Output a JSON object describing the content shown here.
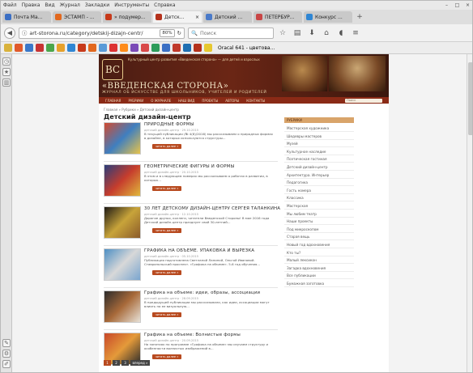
{
  "menu": [
    "Файл",
    "Правка",
    "Вид",
    "Журнал",
    "Закладки",
    "Инструменты",
    "Справка"
  ],
  "window_controls": [
    "–",
    "□",
    "×"
  ],
  "tabs": [
    {
      "label": "Почта Ма...",
      "color": "#3b6fc4"
    },
    {
      "label": "ЭСТАМП - ...",
      "color": "#e2681e"
    },
    {
      "label": "» подумер...",
      "color": "#c73a1b"
    },
    {
      "label": "Детск...",
      "color": "#b5321c",
      "active": true
    },
    {
      "label": "Детский ...",
      "color": "#4a7ac9"
    },
    {
      "label": "ПЕТЕРБУР...",
      "color": "#c94646"
    },
    {
      "label": "Конкурс ...",
      "color": "#2f86d4"
    }
  ],
  "nav": {
    "url": "art-storona.ru/category/detskij-dizajn-centr/",
    "zoom": "80%",
    "search_placeholder": "Поиск"
  },
  "bookmark_colors": [
    "#d9b23c",
    "#e15a2b",
    "#3a78c9",
    "#c73333",
    "#4ba64b",
    "#e6a12b",
    "#2f86d4",
    "#c73a1b",
    "#e2681e",
    "#5a9bd8",
    "#d33",
    "#ff8c1a",
    "#7b4bb7",
    "#d94a4a",
    "#2d9c5a",
    "#3b6fc4",
    "#c0392b",
    "#1f6fb2",
    "#b5321c",
    "#e6c830"
  ],
  "bookmark_label": "Oracal 641 - цветова...",
  "site": {
    "tagline_top": "Культурный центр развития «Введенская сторона» — для детей и взрослых",
    "title": "«ВВЕДЕНСКАЯ СТОРОНА»",
    "subtitle": "ЖУРНАЛ ОБ ИСКУССТВЕ ДЛЯ ШКОЛЬНИКОВ, УЧИТЕЛЕЙ И РОДИТЕЛЕЙ",
    "nav": [
      "ГЛАВНАЯ",
      "РУБРИКИ",
      "О ЖУРНАЛЕ",
      "НАШ ВИД",
      "ПРОЕКТЫ",
      "АВТОРЫ",
      "КОНТАКТЫ"
    ],
    "search_placeholder": "Поиск"
  },
  "breadcrumb": "Главная » Рубрики » Детский дизайн-центр",
  "page_title": "Детский дизайн-центр",
  "posts": [
    {
      "title": "ПРИРОДНЫЕ ФОРМЫ",
      "meta": "детский дизайн-центр · 29.10.2015",
      "excerpt": "В текущей публикации (№ 4(8)/2016) мы рассказываем о природных формах в дизайне, в которых используются структуры...",
      "read_more": "читать далее »",
      "colors": [
        "#d24a2f",
        "#3f7fc0",
        "#e8c34a"
      ]
    },
    {
      "title": "ГЕОМЕТРИЧЕСКИЕ ФИГУРЫ И ФОРМЫ",
      "meta": "детский дизайн-центр · 20.10.2015",
      "excerpt": "В этом и в следующем номерах мы рассказываем о работах в развитии, в которых...",
      "read_more": "читать далее »",
      "colors": [
        "#2a3d7a",
        "#c63d2d",
        "#e0b83c"
      ]
    },
    {
      "title": "30 ЛЕТ ДЕТСКОМУ ДИЗАЙН-ЦЕНТРУ СЕРГЕЯ ТАЛАНКИНА",
      "meta": "детский дизайн-центр · 12.10.2015",
      "excerpt": "Дорогие друзья, коллеги, читатели Введенской Стороны! В мае 2016 года Детский дизайн-центр празднует свой 30-летний...",
      "read_more": "читать далее »",
      "colors": [
        "#1e1a16",
        "#c8a43a",
        "#8a5a2a"
      ]
    },
    {
      "title": "ГРАФИКА НА ОБЪЕМЕ. УПАКОВКА И ВЫРЕЗКА",
      "meta": "детский дизайн-центр · 05.10.2015",
      "excerpt": "Публикация подготовлена Светланой Лапиной, Ольгой Ивановой. Ставропольский проспект. «Графика на объеме». 5-6 год обучения...",
      "read_more": "читать далее »",
      "colors": [
        "#4d8fc4",
        "#d8d8d8",
        "#7aa5cf"
      ]
    },
    {
      "title": "Графика на объеме: идеи, образы, ассоциации",
      "meta": "детский дизайн-центр · 28.09.2015",
      "excerpt": "В предыдущей публикации мы рассказывали, как идеи, ассоциации могут влиять на ее визуальную...",
      "read_more": "читать далее »",
      "colors": [
        "#2b2b2b",
        "#a86a3a",
        "#e8e2d8"
      ]
    },
    {
      "title": "Графика на объеме: Волнистые формы",
      "meta": "детский дизайн-центр · 20.09.2015",
      "excerpt": "На занятиях по программе «Графика на объеме» мы изучаем структуру и особенности волнистых изображений в...",
      "read_more": "читать далее »",
      "colors": [
        "#c8482a",
        "#e49a3a",
        "#2c2c2c"
      ]
    }
  ],
  "sidebar": {
    "heading": "РУБРИКИ",
    "items": [
      "Мастерская художника",
      "Шедевры мастеров",
      "Музей",
      "Культурное наследие",
      "Поэтическая гостиная",
      "Детский дизайн-центр",
      "Архитектура. Интерьер",
      "Педагогика",
      "Гость номера",
      "Классика",
      "Мастерская",
      "Мы любим театр",
      "Наши проекты",
      "Под микроскопом",
      "Старая вещь",
      "Новый год вдохновения",
      "Кто ты?",
      "Малый лексикон",
      "Загадка вдохновения",
      "Все публикации",
      "Бумажная заготовка"
    ]
  },
  "pager": [
    "1",
    "2",
    "3",
    "вперед »"
  ]
}
